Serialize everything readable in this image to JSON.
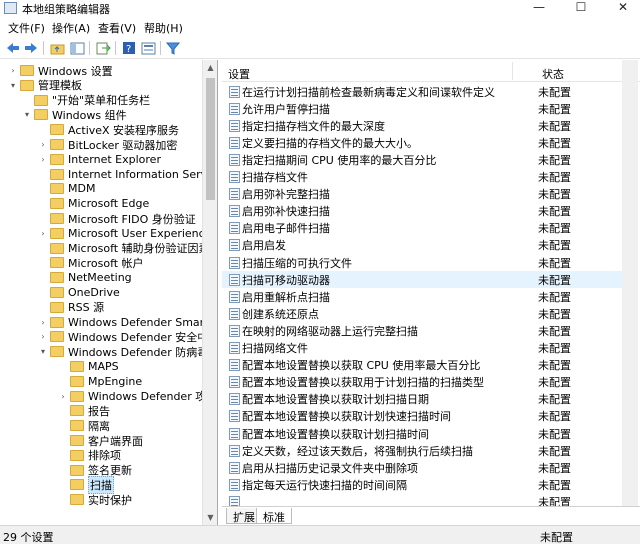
{
  "window": {
    "title": "本地组策略编辑器"
  },
  "menu": [
    "文件(F)",
    "操作(A)",
    "查看(V)",
    "帮助(H)"
  ],
  "tree": [
    {
      "label": "Windows 设置",
      "level": 1,
      "expander": "closed"
    },
    {
      "label": "管理模板",
      "level": 1,
      "expander": "open"
    },
    {
      "label": "\"开始\"菜单和任务栏",
      "level": 2,
      "expander": "none"
    },
    {
      "label": "Windows 组件",
      "level": 2,
      "expander": "open"
    },
    {
      "label": "ActiveX 安装程序服务",
      "level": 3,
      "expander": "none"
    },
    {
      "label": "BitLocker 驱动器加密",
      "level": 3,
      "expander": "closed"
    },
    {
      "label": "Internet Explorer",
      "level": 3,
      "expander": "closed"
    },
    {
      "label": "Internet Information Service",
      "level": 3,
      "expander": "none"
    },
    {
      "label": "MDM",
      "level": 3,
      "expander": "none"
    },
    {
      "label": "Microsoft Edge",
      "level": 3,
      "expander": "none"
    },
    {
      "label": "Microsoft FIDO 身份验证",
      "level": 3,
      "expander": "none"
    },
    {
      "label": "Microsoft User Experience V",
      "level": 3,
      "expander": "closed"
    },
    {
      "label": "Microsoft 辅助身份验证因素",
      "level": 3,
      "expander": "none"
    },
    {
      "label": "Microsoft 帐户",
      "level": 3,
      "expander": "none"
    },
    {
      "label": "NetMeeting",
      "level": 3,
      "expander": "none"
    },
    {
      "label": "OneDrive",
      "level": 3,
      "expander": "none"
    },
    {
      "label": "RSS 源",
      "level": 3,
      "expander": "none"
    },
    {
      "label": "Windows Defender SmartSc",
      "level": 3,
      "expander": "closed"
    },
    {
      "label": "Windows Defender 安全中",
      "level": 3,
      "expander": "closed"
    },
    {
      "label": "Windows Defender 防病毒程",
      "level": 3,
      "expander": "open"
    },
    {
      "label": "MAPS",
      "level": 4,
      "expander": "none"
    },
    {
      "label": "MpEngine",
      "level": 4,
      "expander": "none"
    },
    {
      "label": "Windows Defender 攻击防",
      "level": 4,
      "expander": "closed"
    },
    {
      "label": "报告",
      "level": 4,
      "expander": "none"
    },
    {
      "label": "隔离",
      "level": 4,
      "expander": "none"
    },
    {
      "label": "客户端界面",
      "level": 4,
      "expander": "none"
    },
    {
      "label": "排除项",
      "level": 4,
      "expander": "none"
    },
    {
      "label": "签名更新",
      "level": 4,
      "expander": "none"
    },
    {
      "label": "扫描",
      "level": 4,
      "expander": "none",
      "selected": true
    },
    {
      "label": "实时保护",
      "level": 4,
      "expander": "none"
    }
  ],
  "list": {
    "col_setting": "设置",
    "col_state": "状态",
    "rows": [
      {
        "name": "在运行计划扫描前检查最新病毒定义和间谍软件定义",
        "state": "未配置"
      },
      {
        "name": "允许用户暂停扫描",
        "state": "未配置"
      },
      {
        "name": "指定扫描存档文件的最大深度",
        "state": "未配置"
      },
      {
        "name": "定义要扫描的存档文件的最大大小。",
        "state": "未配置"
      },
      {
        "name": "指定扫描期间 CPU 使用率的最大百分比",
        "state": "未配置"
      },
      {
        "name": "扫描存档文件",
        "state": "未配置"
      },
      {
        "name": "启用弥补完整扫描",
        "state": "未配置"
      },
      {
        "name": "启用弥补快速扫描",
        "state": "未配置"
      },
      {
        "name": "启用电子邮件扫描",
        "state": "未配置"
      },
      {
        "name": "启用启发",
        "state": "未配置"
      },
      {
        "name": "扫描压缩的可执行文件",
        "state": "未配置"
      },
      {
        "name": "扫描可移动驱动器",
        "state": "未配置",
        "selected": true
      },
      {
        "name": "启用重解析点扫描",
        "state": "未配置"
      },
      {
        "name": "创建系统还原点",
        "state": "未配置"
      },
      {
        "name": "在映射的网络驱动器上运行完整扫描",
        "state": "未配置"
      },
      {
        "name": "扫描网络文件",
        "state": "未配置"
      },
      {
        "name": "配置本地设置替换以获取 CPU 使用率最大百分比",
        "state": "未配置"
      },
      {
        "name": "配置本地设置替换以获取用于计划扫描的扫描类型",
        "state": "未配置"
      },
      {
        "name": "配置本地设置替换以获取计划扫描日期",
        "state": "未配置"
      },
      {
        "name": "配置本地设置替换以获取计划快速扫描时间",
        "state": "未配置"
      },
      {
        "name": "配置本地设置替换以获取计划扫描时间",
        "state": "未配置"
      },
      {
        "name": "定义天数，经过该天数后，将强制执行后续扫描",
        "state": "未配置"
      },
      {
        "name": "启用从扫描历史记录文件夹中删除项",
        "state": "未配置"
      },
      {
        "name": "指定每天运行快速扫描的时间间隔",
        "state": "未配置"
      },
      {
        "name": "",
        "state": "未配置"
      }
    ]
  },
  "tabs": [
    "扩展",
    "标准"
  ],
  "status": {
    "count": "29 个设置",
    "state": "未配置"
  }
}
